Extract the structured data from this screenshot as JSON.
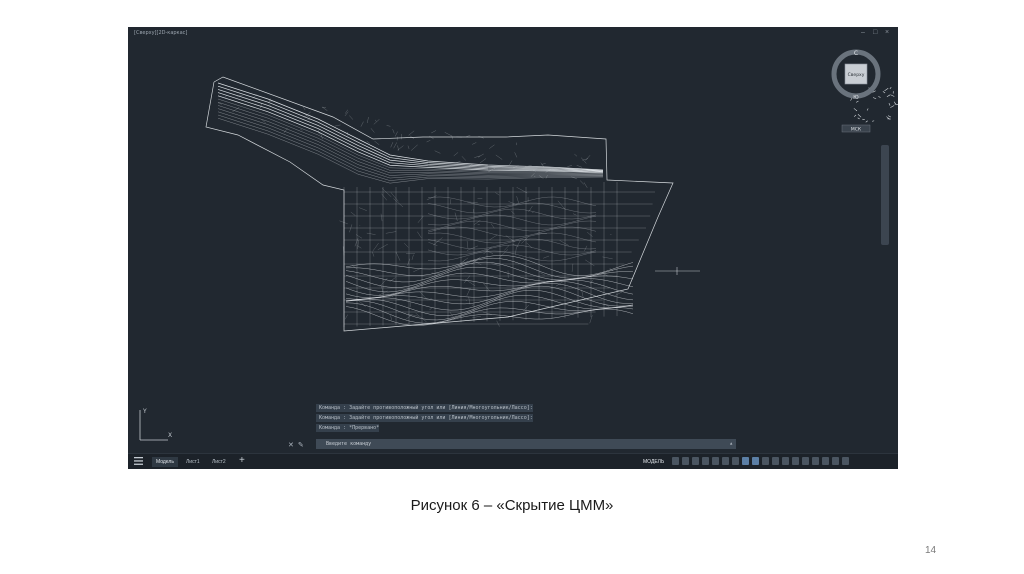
{
  "window": {
    "title": "[Сверху][2D-каркас]",
    "controls": [
      "–",
      "□",
      "×"
    ]
  },
  "viewcube": {
    "compass_north": "С",
    "face": "Сверху",
    "compass_south": "Ю",
    "wcs_label": "МСК"
  },
  "command_history": [
    "Команда : Задайте противоположный угол или  [Линия/Многоугольник/Лассо]:",
    "Команда : Задайте противоположный угол или  [Линия/Многоугольник/Лассо]:",
    "Команда : *Прервано*"
  ],
  "command_input": {
    "placeholder": "Введите команду"
  },
  "status_bar": {
    "tabs": [
      "Модель",
      "Лист1",
      "Лист2"
    ],
    "active_tab": 0,
    "model_space": "МОДЕЛЬ"
  },
  "ucs": {
    "x_label": "X",
    "y_label": "Y"
  },
  "caption": "Рисунок 6 – «Скрытие ЦММ»",
  "page_number": "14",
  "colors": {
    "background": "#212830",
    "wireframe": "#e8ecf0",
    "page": "#ffffff"
  }
}
